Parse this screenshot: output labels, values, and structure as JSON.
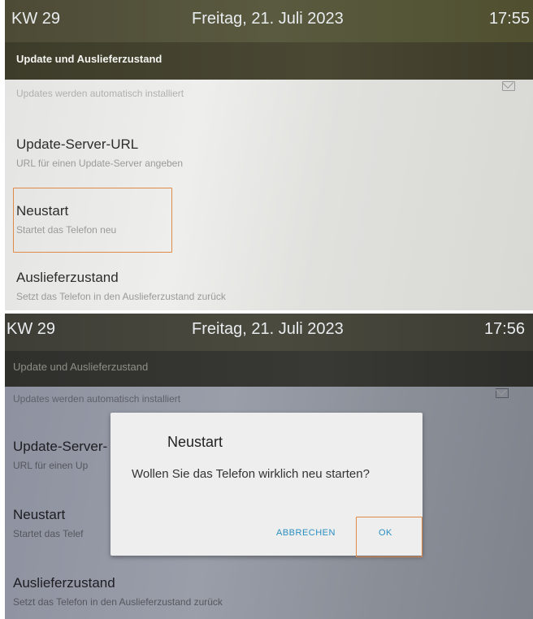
{
  "top_screen": {
    "statusbar": {
      "week": "KW 29",
      "date": "Freitag, 21. Juli 2023",
      "time": "17:55"
    },
    "title": "Update und Auslieferzustand",
    "partial_item_sub": "Updates werden automatisch installiert",
    "items": [
      {
        "title": "Update-Server-URL",
        "sub": "URL für einen Update-Server angeben"
      },
      {
        "title": "Neustart",
        "sub": "Startet das Telefon neu"
      },
      {
        "title": "Auslieferzustand",
        "sub": "Setzt das Telefon in den Auslieferzustand zurück"
      }
    ]
  },
  "bottom_screen": {
    "statusbar": {
      "week": "KW 29",
      "date": "Freitag, 21. Juli 2023",
      "time": "17:56"
    },
    "title": "Update und Auslieferzustand",
    "partial_item_sub": "Updates werden automatisch installiert",
    "items": [
      {
        "title": "Update-Server-",
        "sub": "URL für einen Up"
      },
      {
        "title": "Neustart",
        "sub": "Startet das Telef"
      },
      {
        "title": "Auslieferzustand",
        "sub": "Setzt das Telefon in den Auslieferzustand zurück"
      }
    ],
    "dialog": {
      "title": "Neustart",
      "message": "Wollen Sie das Telefon wirklich neu starten?",
      "cancel_label": "ABBRECHEN",
      "ok_label": "OK"
    }
  },
  "colors": {
    "highlight": "#e08a4a",
    "dialog_button": "#2a8fc0"
  }
}
